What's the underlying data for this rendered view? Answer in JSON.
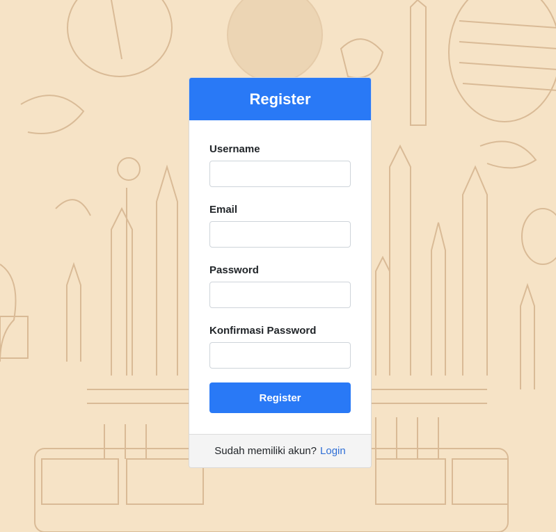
{
  "form": {
    "title": "Register",
    "fields": [
      {
        "label": "Username",
        "value": "",
        "placeholder": ""
      },
      {
        "label": "Email",
        "value": "",
        "placeholder": ""
      },
      {
        "label": "Password",
        "value": "",
        "placeholder": ""
      },
      {
        "label": "Konfirmasi Password",
        "value": "",
        "placeholder": ""
      }
    ],
    "submit_label": "Register"
  },
  "footer": {
    "prompt": "Sudah memiliki akun?",
    "link_label": "Login"
  },
  "colors": {
    "background": "#f6e3c6",
    "sketch_lines": "#d4b48e",
    "primary": "#2979f6",
    "link": "#2f6fd6"
  }
}
